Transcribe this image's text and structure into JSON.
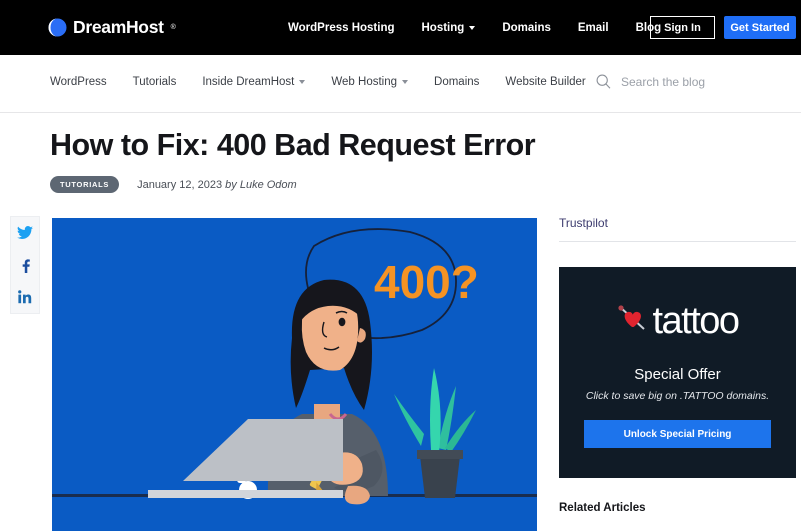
{
  "header": {
    "logo": {
      "text": "DreamHost",
      "tm": "®",
      "icon": "dreamhost-moon-icon",
      "color": "#2a6df5"
    },
    "nav": [
      {
        "label": "WordPress Hosting",
        "dropdown": false
      },
      {
        "label": "Hosting",
        "dropdown": true
      },
      {
        "label": "Domains",
        "dropdown": false
      },
      {
        "label": "Email",
        "dropdown": false
      },
      {
        "label": "Blog",
        "dropdown": false
      }
    ],
    "sign_in_label": "Sign In",
    "get_started_label": "Get Started",
    "background": "#000000",
    "accent": "#1f6ef7"
  },
  "subnav": {
    "items": [
      {
        "label": "WordPress",
        "dropdown": false
      },
      {
        "label": "Tutorials",
        "dropdown": false
      },
      {
        "label": "Inside DreamHost",
        "dropdown": true
      },
      {
        "label": "Web Hosting",
        "dropdown": true
      },
      {
        "label": "Domains",
        "dropdown": false
      },
      {
        "label": "Website Builder",
        "dropdown": false
      }
    ],
    "search": {
      "placeholder": "Search the blog",
      "value": "",
      "icon": "search-icon"
    }
  },
  "article": {
    "title": "How to Fix: 400 Bad Request Error",
    "category": "TUTORIALS",
    "date": "January 12, 2023",
    "byline": "by Luke Odom",
    "hero": {
      "error_code": "400?",
      "exclamation": "!",
      "background": "#0a5bc4",
      "code_color": "#f59324"
    }
  },
  "social": {
    "items": [
      {
        "name": "twitter",
        "glyph": "twitter-icon",
        "color": "#1da1f2"
      },
      {
        "name": "facebook",
        "glyph": "facebook-icon",
        "color": "#1b4d9e"
      },
      {
        "name": "linkedin",
        "glyph": "linkedin-icon",
        "color": "#1b6bb0"
      }
    ]
  },
  "sidebar": {
    "trustpilot_label": "Trustpilot",
    "ad": {
      "brand": "tattoo",
      "logo_icon": "heart-needle-icon",
      "offer_title": "Special Offer",
      "offer_subtitle": "Click to save big on .TATTOO domains.",
      "button_label": "Unlock Special Pricing",
      "background": "#101b26",
      "button_color": "#1d74ec"
    },
    "related_heading": "Related Articles"
  }
}
